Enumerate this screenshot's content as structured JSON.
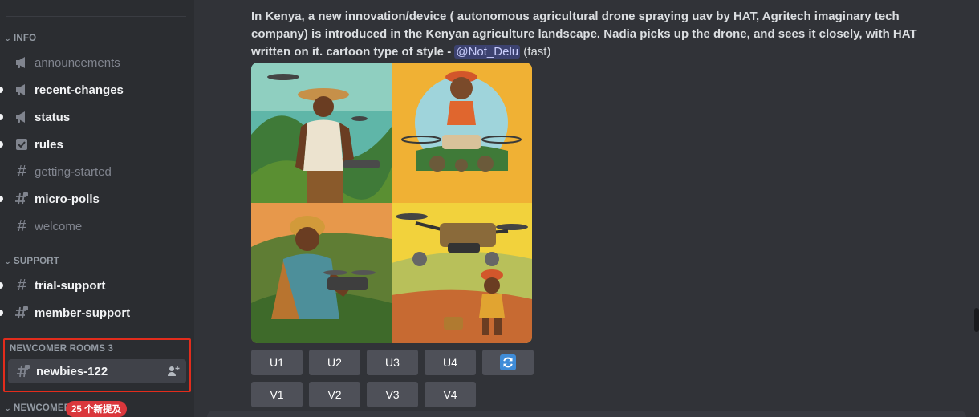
{
  "sidebar": {
    "categories": {
      "info": "INFO",
      "support": "SUPPORT",
      "newcomer_rooms": "NEWCOMER ROOMS 3",
      "newcomer_partial": "NEWCOMER"
    },
    "channels": [
      {
        "name": "announcements",
        "icon": "megaphone-icon",
        "unread": false
      },
      {
        "name": "recent-changes",
        "icon": "megaphone-icon",
        "unread": true
      },
      {
        "name": "status",
        "icon": "megaphone-icon",
        "unread": true
      },
      {
        "name": "rules",
        "icon": "checkbox-icon",
        "unread": true
      },
      {
        "name": "getting-started",
        "icon": "hash-icon",
        "unread": false
      },
      {
        "name": "micro-polls",
        "icon": "hash-lock-icon",
        "unread": true
      },
      {
        "name": "welcome",
        "icon": "hash-icon",
        "unread": false
      },
      {
        "name": "trial-support",
        "icon": "hash-icon",
        "unread": true
      },
      {
        "name": "member-support",
        "icon": "hash-lock-icon",
        "unread": true
      },
      {
        "name": "newbies-122",
        "icon": "hash-lock-icon",
        "unread": false,
        "selected": true
      }
    ],
    "mention_badge": "25 个新提及"
  },
  "message": {
    "prompt": "In Kenya, a new innovation/device ( autonomous agricultural drone spraying uav by HAT, Agritech imaginary tech company) is introduced in the Kenyan agriculture landscape. Nadia picks up the drone, and sees it closely, with HAT written on it. cartoon type of style -",
    "mention": "@Not_Delu",
    "mode": "(fast)"
  },
  "buttons": {
    "upscale": [
      "U1",
      "U2",
      "U3",
      "U4"
    ],
    "variation": [
      "V1",
      "V2",
      "V3",
      "V4"
    ],
    "reroll_icon": "refresh-icon"
  },
  "colors": {
    "sidebar_bg": "#2b2d31",
    "main_bg": "#313338",
    "selected_bg": "#404249",
    "highlight_box": "#e22c1c",
    "button_bg": "#4e5058",
    "reroll_blue": "#3f8cd8",
    "badge_red": "#da373c",
    "mention_bg": "#3c4270"
  }
}
